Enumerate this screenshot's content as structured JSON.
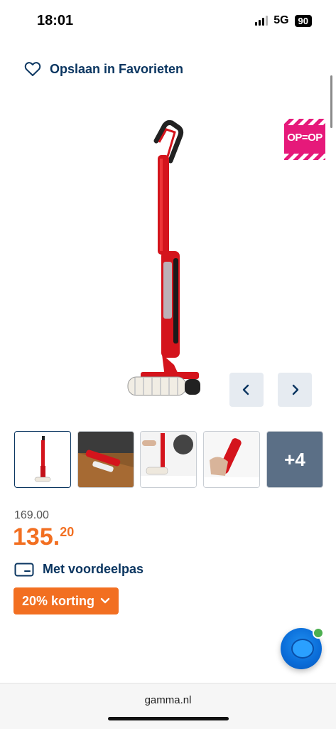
{
  "status_bar": {
    "time": "18:01",
    "network": "5G",
    "battery": "90"
  },
  "favorites": {
    "label": "Opslaan in Favorieten",
    "icon": "heart-outline-icon"
  },
  "badge": {
    "text": "OP=OP",
    "color": "#e6197a"
  },
  "gallery": {
    "prev_icon": "chevron-left-icon",
    "next_icon": "chevron-right-icon",
    "more_count": "+4"
  },
  "price": {
    "old": "169.00",
    "new_main": "135.",
    "new_cents": "20",
    "color": "#f26f21"
  },
  "loyalty": {
    "label": "Met voordeelpas",
    "icon": "card-icon"
  },
  "discount": {
    "label": "20% korting",
    "icon": "chevron-down-icon"
  },
  "footer": {
    "domain": "gamma.nl"
  },
  "colors": {
    "brand_blue": "#0a3560",
    "accent_orange": "#f26f21"
  }
}
